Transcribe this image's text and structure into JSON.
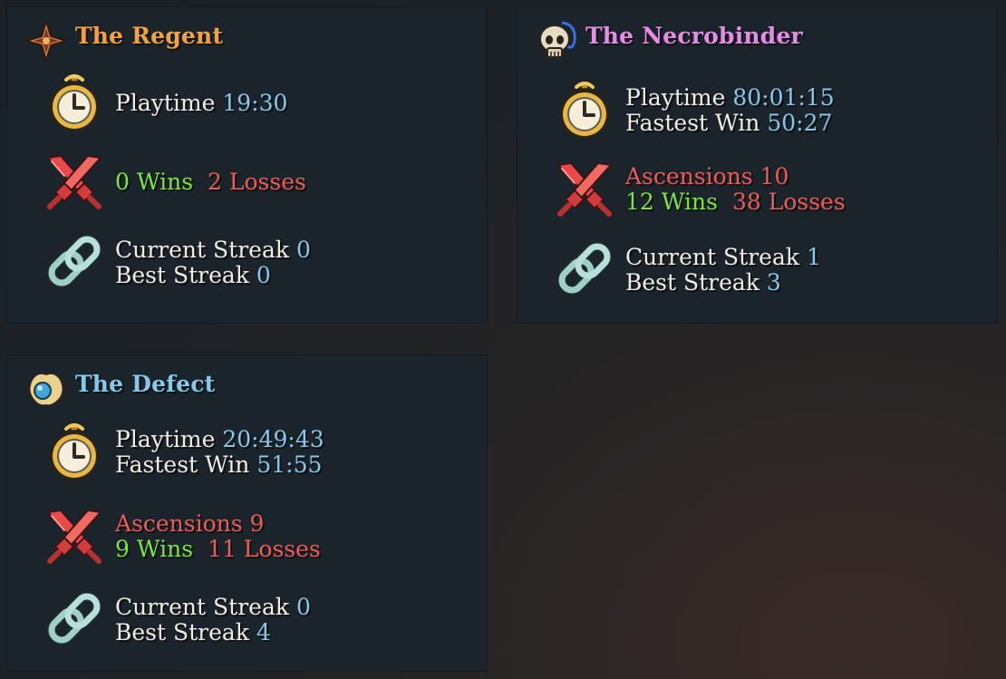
{
  "colors": {
    "regent": "#f5a23b",
    "necrobinder": "#e78be6",
    "defect": "#87c7ea",
    "value_blue": "#87c7ea",
    "wins_green": "#7ee43a",
    "losses_red": "#ef5a56",
    "label_white": "#f2ede3"
  },
  "characters": [
    {
      "name": "The Regent",
      "icon": "regent-star-icon",
      "playtime_label": "Playtime",
      "playtime": "19:30",
      "wins": "0 Wins",
      "losses": "2 Losses",
      "current_streak_label": "Current Streak",
      "current_streak": "0",
      "best_streak_label": "Best Streak",
      "best_streak": "0"
    },
    {
      "name": "The Necrobinder",
      "icon": "skull-icon",
      "playtime_label": "Playtime",
      "playtime": "80:01:15",
      "fastest_label": "Fastest Win",
      "fastest": "50:27",
      "ascensions_label": "Ascensions",
      "ascensions": "10",
      "wins": "12 Wins",
      "losses": "38 Losses",
      "current_streak_label": "Current Streak",
      "current_streak": "1",
      "best_streak_label": "Best Streak",
      "best_streak": "3"
    },
    {
      "name": "The Defect",
      "icon": "defect-orb-icon",
      "playtime_label": "Playtime",
      "playtime": "20:49:43",
      "fastest_label": "Fastest Win",
      "fastest": "51:55",
      "ascensions_label": "Ascensions",
      "ascensions": "9",
      "wins": "9 Wins",
      "losses": "11 Losses",
      "current_streak_label": "Current Streak",
      "current_streak": "0",
      "best_streak_label": "Best Streak",
      "best_streak": "4"
    }
  ],
  "stat_icons": {
    "playtime": "stopwatch-icon",
    "record": "crossed-swords-icon",
    "streak": "chain-link-icon"
  }
}
